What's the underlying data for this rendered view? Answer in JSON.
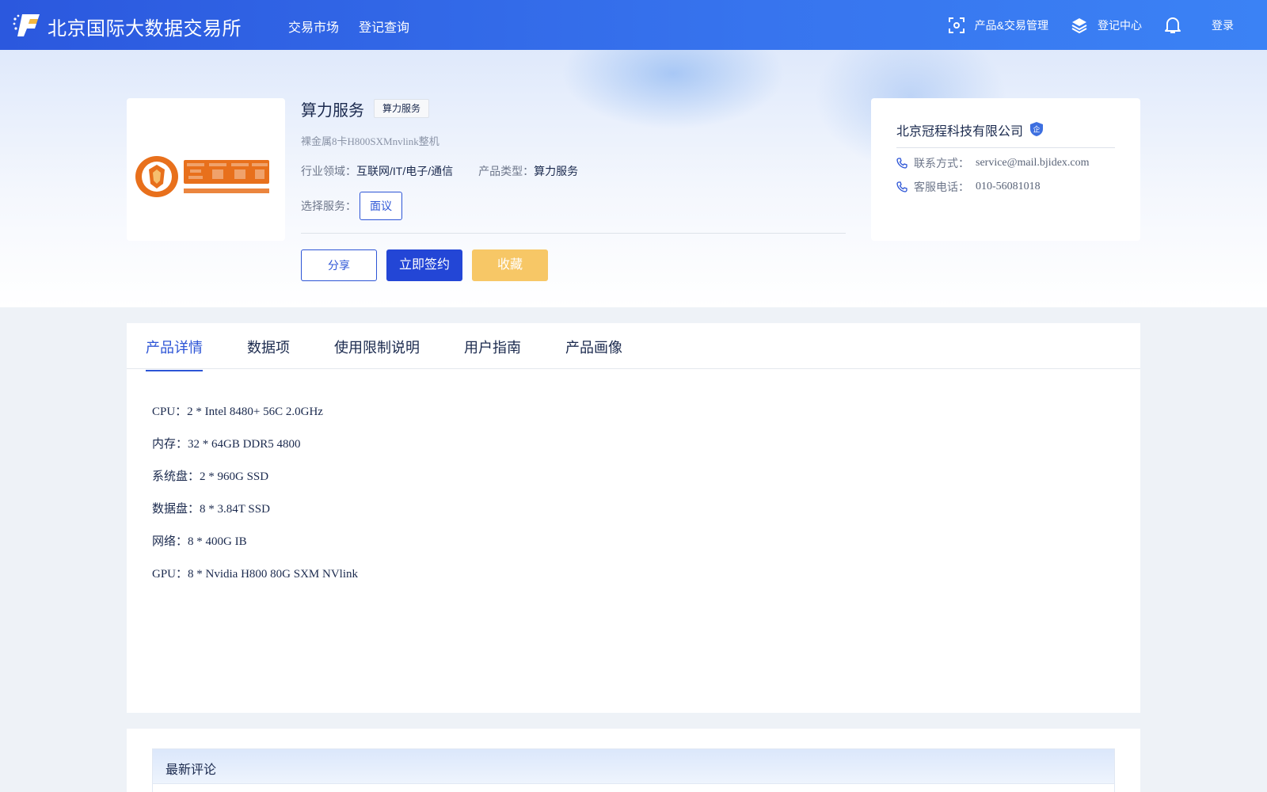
{
  "header": {
    "brand": "北京国际大数据交易所",
    "nav": [
      "交易市场",
      "登记查询"
    ],
    "product_trade_mgmt": "产品&交易管理",
    "register_center": "登记中心",
    "login": "登录"
  },
  "product": {
    "title": "算力服务",
    "tag": "算力服务",
    "subtitle": "裸金属8卡H800SXMnvlink整机",
    "industry_label": "行业领域：",
    "industry_value": "互联网/IT/电子/通信",
    "type_label": "产品类型：",
    "type_value": "算力服务",
    "service_label": "选择服务：",
    "service_option": "面议",
    "share": "分享",
    "sign": "立即签约",
    "favorite": "收藏"
  },
  "company": {
    "name": "北京冠程科技有限公司",
    "badge": "企",
    "contact_label": "联系方式：",
    "contact_value": "service@mail.bjidex.com",
    "phone_label": "客服电话：",
    "phone_value": "010-56081018"
  },
  "tabs": [
    "产品详情",
    "数据项",
    "使用限制说明",
    "用户指南",
    "产品画像"
  ],
  "details": [
    "CPU：2 * Intel 8480+ 56C 2.0GHz",
    "内存：32 * 64GB DDR5 4800",
    "系统盘：2 * 960G SSD",
    "数据盘：8 * 3.84T SSD",
    "网络：8 * 400G IB",
    "GPU：8 * Nvidia H800 80G SXM NVlink"
  ],
  "comments": {
    "title": "最新评论"
  },
  "colors": {
    "primary": "#2d55d6",
    "header_start": "#2b58de",
    "header_end": "#3b82f5",
    "favorite": "#f7c766",
    "logo_orange": "#e8701c"
  }
}
